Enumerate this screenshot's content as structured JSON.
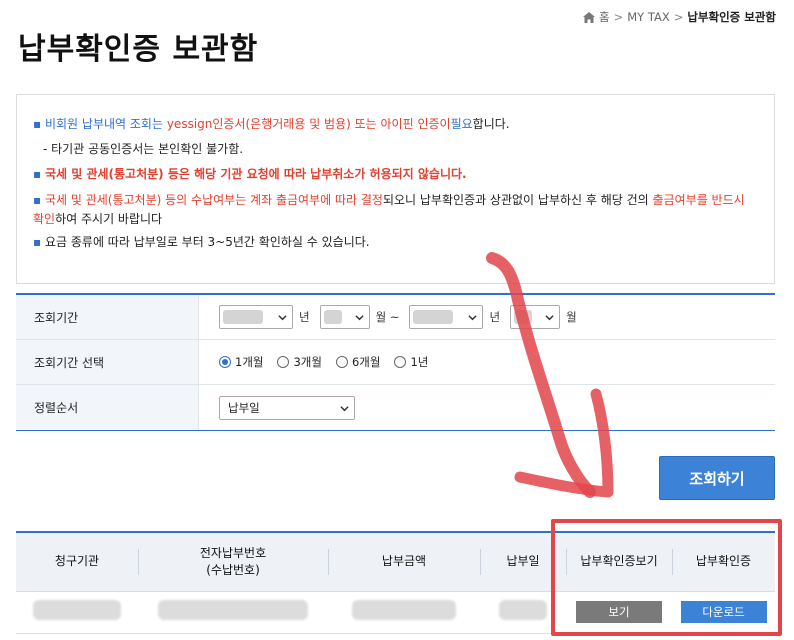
{
  "breadcrumb": {
    "home": "홈",
    "section": "MY TAX",
    "current": "납부확인증 보관함",
    "sep": ">"
  },
  "page": {
    "title": "납부확인증 보관함"
  },
  "notice": {
    "line1_blue": "비회원 납부내역 조회는",
    "line1_red": "yessign인증서(은행거래용 및 범용) 또는 아이핀 인증이",
    "line1_blue2": "필요",
    "line1_end": "합니다.",
    "line2": "- 타기관 공동인증서는 본인확인 불가함.",
    "line3": "국세 및 관세(통고처분) 등은 해당 기관 요청에 따라 납부취소가 허용되지 않습니다.",
    "line4_red": "국세 및 관세(통고처분) 등의 수납여부는 계좌 출금여부에 따라 결정",
    "line4_mid": "되오니 납부확인증과 상관없이 납부하신 후 해당 건의",
    "line4_red2": "출금여부를 반드시 확인",
    "line4_end": "하여 주시기 바랍니다",
    "line5": "요금 종류에 따라 납부일로 부터 3~5년간 확인하실 수 있습니다."
  },
  "form": {
    "period_label": "조회기간",
    "year_unit": "년",
    "month_unit": "월",
    "tilde": "~",
    "period_select_label": "조회기간 선택",
    "radios": [
      "1개월",
      "3개월",
      "6개월",
      "1년"
    ],
    "sort_label": "정렬순서",
    "sort_value": "납부일"
  },
  "search_button": "조회하기",
  "results": {
    "headers": [
      "청구기관",
      "전자납부번호\n(수납번호)",
      "납부금액",
      "납부일",
      "납부확인증보기",
      "납부확인증"
    ],
    "header_line1": "전자납부번호",
    "header_line2": "(수납번호)",
    "view_button": "보기",
    "download_button": "다운로드"
  },
  "colors": {
    "accent": "#2e6fd0",
    "button_blue": "#3c82d6",
    "annotation_red": "#e2454a"
  }
}
